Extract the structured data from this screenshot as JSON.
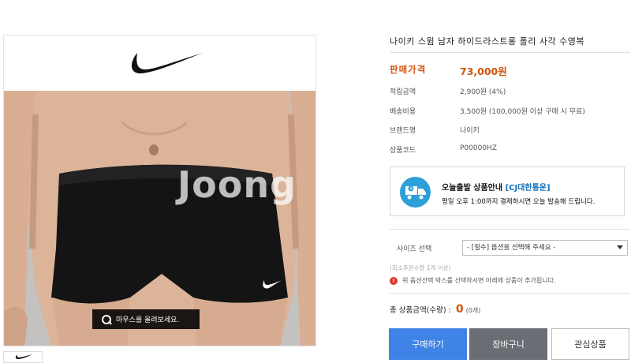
{
  "product": {
    "title": "나이키 스윔 남자 하이드라스트롱 폴리 사각 수영복",
    "price_label": "판매가격",
    "price_value": "73,000원",
    "specs": [
      {
        "label": "적립금액",
        "value": "2,900원 (4%)"
      },
      {
        "label": "배송비용",
        "value": "3,500원 (100,000원 이상 구매 시 무료)"
      },
      {
        "label": "브랜드명",
        "value": "나이키"
      },
      {
        "label": "상품코드",
        "value": "P00000HZ"
      }
    ]
  },
  "image_panel": {
    "watermark": "Joong",
    "zoom_hint": "마우스를 올려보세요."
  },
  "shipping": {
    "title_prefix": "오늘출발 상품안내",
    "courier": "[CJ대한통운]",
    "description": "평일 오후 1:00까지 결제하시면 오늘 발송해 드립니다."
  },
  "options": {
    "label": "사이즈 선택",
    "selected": "- [필수] 옵션을 선택해 주세요 -",
    "min_order_note": "(최소주문수량 1개 이상)",
    "notice": "위 옵션선택 박스를 선택하시면 아래에 상품이 추가됩니다.",
    "notice_mark": "!"
  },
  "total": {
    "label": "총 상품금액(수량) :",
    "amount": "0",
    "count": "(0개)"
  },
  "buttons": {
    "buy": "구매하기",
    "cart": "장바구니",
    "wishlist": "관심상품"
  },
  "colors": {
    "accent_price": "#d2540b",
    "buy_button": "#3f83e6",
    "cart_button": "#6a6e74",
    "shipping_icon": "#2d9fd9"
  },
  "icons": {
    "logo": "nike-swoosh-logo",
    "zoom": "magnifier-icon",
    "shipping": "delivery-truck-icon",
    "notice": "alert-icon",
    "select_arrow": "chevron-down-icon"
  }
}
